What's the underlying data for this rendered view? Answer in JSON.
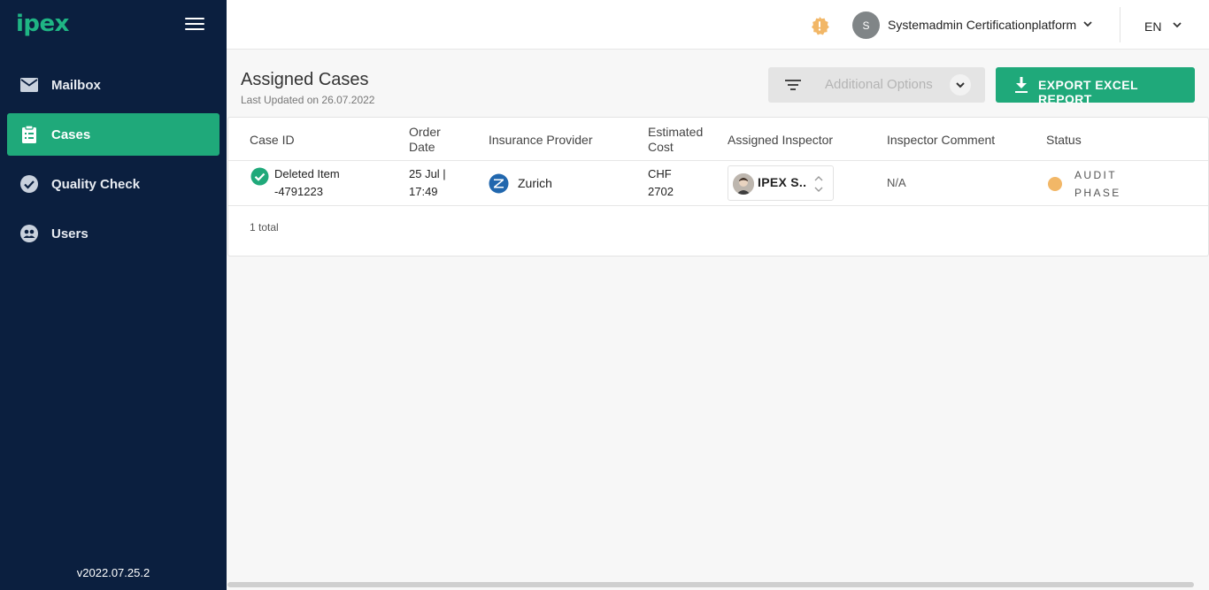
{
  "app": {
    "logo_text": "ipex",
    "version": "v2022.07.25.2"
  },
  "sidebar": {
    "items": [
      {
        "label": "Mailbox",
        "icon": "mail-icon",
        "active": false
      },
      {
        "label": "Cases",
        "icon": "clipboard-icon",
        "active": true
      },
      {
        "label": "Quality Check",
        "icon": "check-circle-icon",
        "active": false
      },
      {
        "label": "Users",
        "icon": "users-icon",
        "active": false
      }
    ]
  },
  "topbar": {
    "user_initial": "S",
    "user_name": "Systemadmin Certificationplatform",
    "language": "EN",
    "warning_color": "#f2b767"
  },
  "page": {
    "title": "Assigned Cases",
    "subtitle": "Last Updated on 26.07.2022",
    "options_label": "Additional Options",
    "export_label": "EXPORT EXCEL REPORT"
  },
  "table": {
    "headers": {
      "case_id": "Case ID",
      "order_date_1": "Order",
      "order_date_2": "Date",
      "provider": "Insurance Provider",
      "cost_1": "Estimated",
      "cost_2": "Cost",
      "inspector": "Assigned Inspector",
      "comment": "Inspector Comment",
      "status": "Status"
    },
    "rows": [
      {
        "case_id_1": "Deleted Item",
        "case_id_2": "-4791223",
        "date_1": "25 Jul |",
        "date_2": "17:49",
        "provider": "Zurich",
        "cost_1": "CHF",
        "cost_2": "2702",
        "inspector": "IPEX S..",
        "comment": "N/A",
        "status_1": "AUDIT",
        "status_2": "PHASE",
        "status_color": "#f2b767"
      }
    ],
    "total": "1 total"
  },
  "colors": {
    "sidebar": "#0b1f3f",
    "accent": "#1fa97a",
    "logo": "#1fb584"
  }
}
